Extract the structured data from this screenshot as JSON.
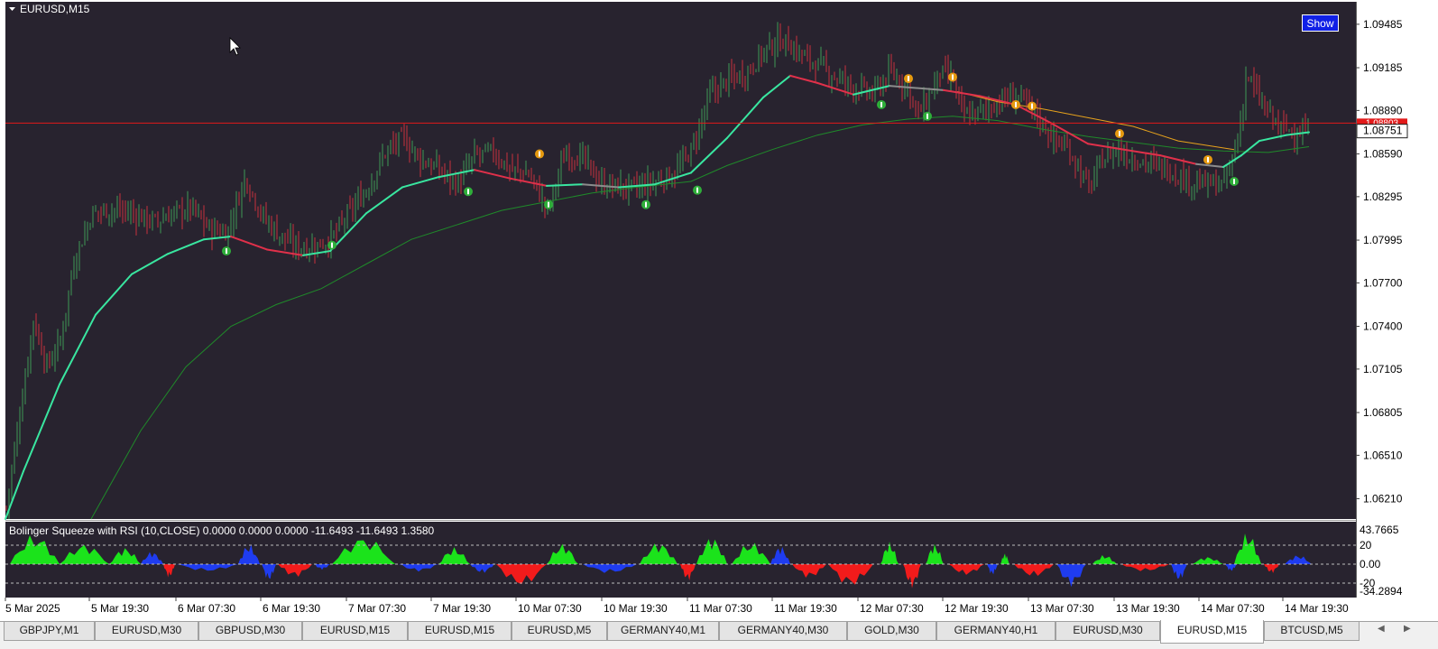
{
  "window": {
    "title": "EURUSD,M15",
    "show_button": "Show"
  },
  "price_axis": {
    "labels": [
      "1.09485",
      "1.09185",
      "1.08890",
      "1.08590",
      "1.08295",
      "1.07995",
      "1.07700",
      "1.07400",
      "1.07105",
      "1.06805",
      "1.06510",
      "1.06210"
    ],
    "current_price": "1.08751",
    "red_line_price": "1.08803"
  },
  "indicator": {
    "title": "Bolinger Squeeze with RSI (10,CLOSE) 0.0000 0.0000 0.0000 -11.6493 -11.6493 1.3580",
    "axis_labels": [
      "43.7665",
      "20",
      "0.00",
      "-20",
      "-34.2894"
    ]
  },
  "time_axis": {
    "labels": [
      "5 Mar 2025",
      "5 Mar 19:30",
      "6 Mar 07:30",
      "6 Mar 19:30",
      "7 Mar 07:30",
      "7 Mar 19:30",
      "10 Mar 07:30",
      "10 Mar 19:30",
      "11 Mar 07:30",
      "11 Mar 19:30",
      "12 Mar 07:30",
      "12 Mar 19:30",
      "13 Mar 07:30",
      "13 Mar 19:30",
      "14 Mar 07:30",
      "14 Mar 19:30"
    ]
  },
  "tabs": [
    {
      "label": "GBPJPY,M1",
      "active": false
    },
    {
      "label": "EURUSD,M30",
      "active": false
    },
    {
      "label": "GBPUSD,M30",
      "active": false
    },
    {
      "label": "EURUSD,M15",
      "active": false
    },
    {
      "label": "EURUSD,M15",
      "active": false
    },
    {
      "label": "EURUSD,M5",
      "active": false
    },
    {
      "label": "GERMANY40,M1",
      "active": false
    },
    {
      "label": "GERMANY40,M30",
      "active": false
    },
    {
      "label": "GOLD,M30",
      "active": false
    },
    {
      "label": "GERMANY40,H1",
      "active": false
    },
    {
      "label": "EURUSD,M30",
      "active": false
    },
    {
      "label": "EURUSD,M15",
      "active": true
    },
    {
      "label": "BTCUSD,M5",
      "active": false
    }
  ],
  "colors": {
    "chart_bg": "#28232f",
    "axis_bg": "#ffffff",
    "bull": "#3e9a55",
    "bear": "#c8303e",
    "fast_ma": "#39e6a0",
    "slow_ma": "#1f8a2a",
    "declining_ma": "#e0304a",
    "resist_ma": "#e6a21c",
    "flat_ma": "#8c8c8c",
    "price_line": "#e21a1a",
    "osc_green": "#1be31b",
    "osc_red": "#f21b1b",
    "osc_blue": "#1f3cf0"
  },
  "chart_data": {
    "type": "candlestick",
    "symbol": "EURUSD",
    "timeframe": "M15",
    "y_range": [
      1.0607,
      1.0964
    ],
    "close_path": [
      [
        0,
        1.0615
      ],
      [
        15,
        1.068
      ],
      [
        30,
        1.0745
      ],
      [
        45,
        1.0712
      ],
      [
        60,
        1.073
      ],
      [
        75,
        1.0785
      ],
      [
        95,
        1.0818
      ],
      [
        115,
        1.0821
      ],
      [
        140,
        1.0818
      ],
      [
        165,
        1.0812
      ],
      [
        185,
        1.0818
      ],
      [
        205,
        1.0822
      ],
      [
        225,
        1.0807
      ],
      [
        245,
        1.0805
      ],
      [
        265,
        1.0843
      ],
      [
        285,
        1.0815
      ],
      [
        305,
        1.0802
      ],
      [
        320,
        1.0795
      ],
      [
        340,
        1.0795
      ],
      [
        360,
        1.08
      ],
      [
        380,
        1.0818
      ],
      [
        400,
        1.0835
      ],
      [
        420,
        1.086
      ],
      [
        440,
        1.087
      ],
      [
        460,
        1.0855
      ],
      [
        480,
        1.0848
      ],
      [
        500,
        1.0838
      ],
      [
        520,
        1.0858
      ],
      [
        540,
        1.086
      ],
      [
        560,
        1.0848
      ],
      [
        580,
        1.0845
      ],
      [
        600,
        1.082
      ],
      [
        620,
        1.086
      ],
      [
        640,
        1.0855
      ],
      [
        660,
        1.0838
      ],
      [
        680,
        1.0836
      ],
      [
        700,
        1.0835
      ],
      [
        720,
        1.084
      ],
      [
        740,
        1.0845
      ],
      [
        760,
        1.0862
      ],
      [
        780,
        1.09
      ],
      [
        800,
        1.091
      ],
      [
        820,
        1.0915
      ],
      [
        840,
        1.093
      ],
      [
        860,
        1.0938
      ],
      [
        880,
        1.0928
      ],
      [
        900,
        1.092
      ],
      [
        920,
        1.0912
      ],
      [
        940,
        1.0905
      ],
      [
        960,
        1.09
      ],
      [
        980,
        1.0915
      ],
      [
        1000,
        1.0905
      ],
      [
        1010,
        1.0885
      ],
      [
        1020,
        1.0895
      ],
      [
        1035,
        1.0915
      ],
      [
        1050,
        1.091
      ],
      [
        1060,
        1.0885
      ],
      [
        1080,
        1.0888
      ],
      [
        1100,
        1.0895
      ],
      [
        1120,
        1.09
      ],
      [
        1140,
        1.0888
      ],
      [
        1160,
        1.087
      ],
      [
        1180,
        1.086
      ],
      [
        1200,
        1.0835
      ],
      [
        1215,
        1.0855
      ],
      [
        1230,
        1.0862
      ],
      [
        1250,
        1.0856
      ],
      [
        1270,
        1.0852
      ],
      [
        1290,
        1.0848
      ],
      [
        1310,
        1.084
      ],
      [
        1330,
        1.0838
      ],
      [
        1350,
        1.0838
      ],
      [
        1365,
        1.0868
      ],
      [
        1375,
        1.0915
      ],
      [
        1390,
        1.0895
      ],
      [
        1410,
        1.0878
      ],
      [
        1430,
        1.0874
      ],
      [
        1445,
        1.0875
      ]
    ],
    "fast_ma": [
      [
        0,
        1.0607
      ],
      [
        20,
        1.064
      ],
      [
        60,
        1.07
      ],
      [
        100,
        1.0748
      ],
      [
        140,
        1.0776
      ],
      [
        180,
        1.079
      ],
      [
        220,
        1.08
      ],
      [
        250,
        1.0802
      ],
      [
        290,
        1.0793
      ],
      [
        330,
        1.0789
      ],
      [
        360,
        1.0792
      ],
      [
        400,
        1.0818
      ],
      [
        440,
        1.0836
      ],
      [
        480,
        1.0843
      ],
      [
        520,
        1.0848
      ],
      [
        560,
        1.0842
      ],
      [
        600,
        1.0837
      ],
      [
        640,
        1.0838
      ],
      [
        680,
        1.0836
      ],
      [
        720,
        1.0838
      ],
      [
        760,
        1.0846
      ],
      [
        800,
        1.087
      ],
      [
        840,
        1.0898
      ],
      [
        870,
        1.0913
      ],
      [
        900,
        1.0908
      ],
      [
        940,
        1.09
      ],
      [
        980,
        1.0906
      ],
      [
        1000,
        1.0905
      ],
      [
        1040,
        1.0903
      ],
      [
        1080,
        1.0899
      ],
      [
        1120,
        1.0893
      ],
      [
        1160,
        1.088
      ],
      [
        1200,
        1.0866
      ],
      [
        1240,
        1.0862
      ],
      [
        1280,
        1.0858
      ],
      [
        1320,
        1.0852
      ],
      [
        1350,
        1.085
      ],
      [
        1370,
        1.0858
      ],
      [
        1390,
        1.0868
      ],
      [
        1420,
        1.0872
      ],
      [
        1445,
        1.0874
      ]
    ],
    "slow_ma": [
      [
        95,
        1.0607
      ],
      [
        150,
        1.0668
      ],
      [
        200,
        1.0712
      ],
      [
        250,
        1.074
      ],
      [
        300,
        1.0755
      ],
      [
        350,
        1.0766
      ],
      [
        400,
        1.0783
      ],
      [
        450,
        1.08
      ],
      [
        500,
        1.081
      ],
      [
        550,
        1.082
      ],
      [
        600,
        1.0826
      ],
      [
        650,
        1.0832
      ],
      [
        700,
        1.0836
      ],
      [
        760,
        1.084
      ],
      [
        800,
        1.0851
      ],
      [
        850,
        1.0862
      ],
      [
        900,
        1.0872
      ],
      [
        950,
        1.0879
      ],
      [
        1000,
        1.0883
      ],
      [
        1050,
        1.0885
      ],
      [
        1100,
        1.0882
      ],
      [
        1150,
        1.0876
      ],
      [
        1200,
        1.0871
      ],
      [
        1250,
        1.0867
      ],
      [
        1300,
        1.0863
      ],
      [
        1350,
        1.0861
      ],
      [
        1400,
        1.086
      ],
      [
        1445,
        1.0864
      ]
    ],
    "resist_ma": [
      [
        1055,
        1.0902
      ],
      [
        1100,
        1.0895
      ],
      [
        1150,
        1.089
      ],
      [
        1200,
        1.0884
      ],
      [
        1250,
        1.0878
      ],
      [
        1300,
        1.0868
      ],
      [
        1362,
        1.0862
      ]
    ],
    "sell_signals": [
      [
        592,
        1.0859
      ],
      [
        1001,
        1.0911
      ],
      [
        1050,
        1.0912
      ],
      [
        1120,
        1.0893
      ],
      [
        1138,
        1.0892
      ],
      [
        1235,
        1.0873
      ],
      [
        1333,
        1.0855
      ]
    ],
    "buy_signals": [
      [
        245,
        1.0792
      ],
      [
        362,
        1.0796
      ],
      [
        513,
        1.0833
      ],
      [
        602,
        1.0824
      ],
      [
        710,
        1.0824
      ],
      [
        767,
        1.0834
      ],
      [
        971,
        1.0893
      ],
      [
        1022,
        1.0885
      ],
      [
        1362,
        1.084
      ]
    ],
    "oscillator": {
      "name": "Bolinger Squeeze with RSI",
      "range": [
        -34.2894,
        43.7665
      ],
      "levels": [
        20,
        0,
        -20
      ],
      "segments": [
        {
          "x0": 5,
          "x1": 60,
          "peak": 32,
          "color": "green"
        },
        {
          "x0": 60,
          "x1": 115,
          "peak": 22,
          "color": "green"
        },
        {
          "x0": 115,
          "x1": 150,
          "peak": 18,
          "color": "green"
        },
        {
          "x0": 150,
          "x1": 175,
          "peak": 14,
          "color": "blue"
        },
        {
          "x0": 175,
          "x1": 188,
          "peak": -15,
          "color": "red"
        },
        {
          "x0": 190,
          "x1": 258,
          "peak": -8,
          "color": "blue"
        },
        {
          "x0": 258,
          "x1": 282,
          "peak": 22,
          "color": "blue"
        },
        {
          "x0": 284,
          "x1": 300,
          "peak": -18,
          "color": "blue"
        },
        {
          "x0": 302,
          "x1": 340,
          "peak": -14,
          "color": "red"
        },
        {
          "x0": 342,
          "x1": 360,
          "peak": -6,
          "color": "blue"
        },
        {
          "x0": 362,
          "x1": 432,
          "peak": 30,
          "color": "green"
        },
        {
          "x0": 436,
          "x1": 480,
          "peak": -8,
          "color": "blue"
        },
        {
          "x0": 480,
          "x1": 515,
          "peak": 18,
          "color": "green"
        },
        {
          "x0": 515,
          "x1": 542,
          "peak": -10,
          "color": "blue"
        },
        {
          "x0": 544,
          "x1": 600,
          "peak": -24,
          "color": "red"
        },
        {
          "x0": 600,
          "x1": 635,
          "peak": 22,
          "color": "green"
        },
        {
          "x0": 640,
          "x1": 700,
          "peak": -10,
          "color": "blue"
        },
        {
          "x0": 703,
          "x1": 745,
          "peak": 24,
          "color": "green"
        },
        {
          "x0": 748,
          "x1": 765,
          "peak": -18,
          "color": "red"
        },
        {
          "x0": 766,
          "x1": 800,
          "peak": 30,
          "color": "green"
        },
        {
          "x0": 805,
          "x1": 848,
          "peak": 24,
          "color": "green"
        },
        {
          "x0": 848,
          "x1": 870,
          "peak": 20,
          "color": "blue"
        },
        {
          "x0": 872,
          "x1": 910,
          "peak": -15,
          "color": "red"
        },
        {
          "x0": 912,
          "x1": 962,
          "peak": -24,
          "color": "red"
        },
        {
          "x0": 970,
          "x1": 990,
          "peak": 24,
          "color": "green"
        },
        {
          "x0": 995,
          "x1": 1015,
          "peak": -26,
          "color": "red"
        },
        {
          "x0": 1020,
          "x1": 1040,
          "peak": 22,
          "color": "green"
        },
        {
          "x0": 1045,
          "x1": 1085,
          "peak": -12,
          "color": "red"
        },
        {
          "x0": 1088,
          "x1": 1100,
          "peak": -12,
          "color": "blue"
        },
        {
          "x0": 1103,
          "x1": 1113,
          "peak": 12,
          "color": "green"
        },
        {
          "x0": 1118,
          "x1": 1162,
          "peak": -14,
          "color": "red"
        },
        {
          "x0": 1165,
          "x1": 1198,
          "peak": -24,
          "color": "blue"
        },
        {
          "x0": 1205,
          "x1": 1232,
          "peak": 10,
          "color": "green"
        },
        {
          "x0": 1237,
          "x1": 1290,
          "peak": -8,
          "color": "red"
        },
        {
          "x0": 1292,
          "x1": 1310,
          "peak": -18,
          "color": "blue"
        },
        {
          "x0": 1315,
          "x1": 1350,
          "peak": 8,
          "color": "green"
        },
        {
          "x0": 1352,
          "x1": 1365,
          "peak": -8,
          "color": "blue"
        },
        {
          "x0": 1362,
          "x1": 1392,
          "peak": 34,
          "color": "green"
        },
        {
          "x0": 1395,
          "x1": 1412,
          "peak": -10,
          "color": "red"
        },
        {
          "x0": 1418,
          "x1": 1448,
          "peak": 10,
          "color": "blue"
        }
      ]
    }
  }
}
